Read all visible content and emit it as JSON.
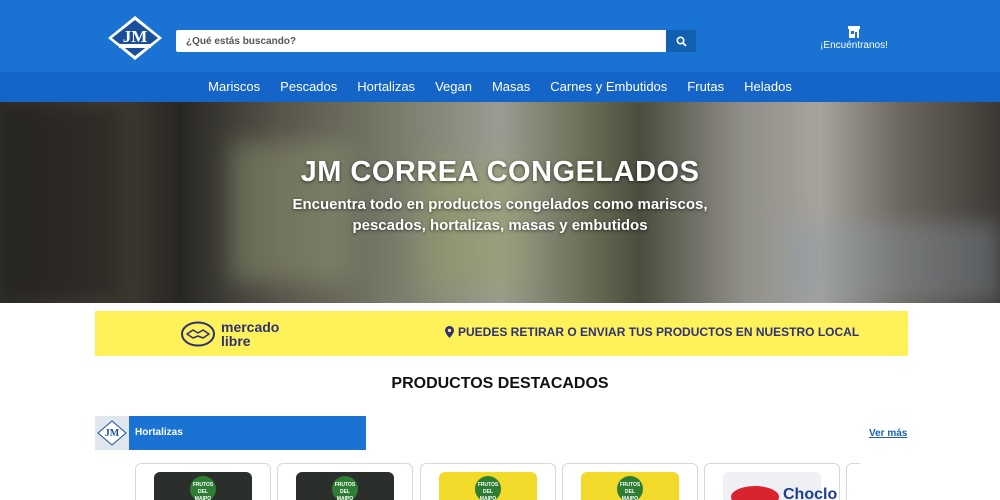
{
  "header": {
    "logo_text": "JM",
    "search": {
      "placeholder": "¿Qué estás buscando?"
    },
    "locate_label": "¡Encuéntranos!"
  },
  "nav": {
    "items": [
      "Mariscos",
      "Pescados",
      "Hortalizas",
      "Vegan",
      "Masas",
      "Carnes y Embutidos",
      "Frutas",
      "Helados"
    ]
  },
  "hero": {
    "title": "JM CORREA CONGELADOS",
    "subtitle": "Encuentra todo en productos congelados como mariscos, pescados, hortalizas, masas y embutidos"
  },
  "mercadolibre": {
    "brand_line1": "mercado",
    "brand_line2": "libre",
    "pickup_text": "PUEDES RETIRAR O ENVIAR TUS PRODUCTOS EN NUESTRO LOCAL"
  },
  "featured": {
    "title": "PRODUCTOS DESTACADOS",
    "category_label": "Hortalizas",
    "category_logo_text": "JM",
    "see_more": "Ver más",
    "products": [
      {
        "badge": "FRUTOS DEL MAIPO"
      },
      {
        "badge": "FRUTOS DEL MAIPO"
      },
      {
        "badge": "FRUTOS DEL MAIPO"
      },
      {
        "badge": "FRUTOS DEL MAIPO"
      },
      {
        "brand_text": "Choclo"
      }
    ]
  },
  "colors": {
    "primary_blue": "#1a73d2",
    "nav_blue": "#1565c8",
    "ml_yellow": "#fff159",
    "ml_navy": "#2d3277"
  }
}
